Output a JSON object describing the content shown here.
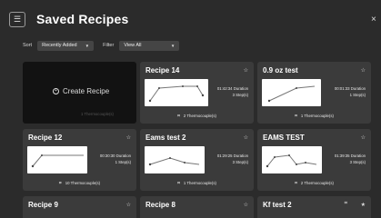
{
  "header": {
    "menu_icon": "☰",
    "title": "Saved Recipes",
    "close_icon": "×"
  },
  "filters": {
    "sort_label": "Sort",
    "sort_value": "Recently Added",
    "filter_label": "Filter",
    "filter_value": "View All",
    "caret": "▼"
  },
  "create": {
    "label": "Create Recipe",
    "plus": "+",
    "ghost": "1 Thermocouple(s)"
  },
  "recipes": [
    {
      "name": "Recipe 14",
      "duration": "01:42:34 Duration",
      "steps": "3 Step(s)",
      "thermocouples": "2 Thermocouple(s)",
      "star": "☆"
    },
    {
      "name": "0.9 oz test",
      "duration": "00:01:33 Duration",
      "steps": "1 Step(s)",
      "thermocouples": "1 Thermocouple(s)",
      "star": "☆"
    },
    {
      "name": "Recipe 12",
      "duration": "00:30:30 Duration",
      "steps": "1 Step(s)",
      "thermocouples": "10 Thermocouple(s)",
      "star": "☆"
    },
    {
      "name": "Eams test 2",
      "duration": "01:29:25 Duration",
      "steps": "3 Step(s)",
      "thermocouples": "1 Thermocouple(s)",
      "star": "☆"
    },
    {
      "name": "EAMS TEST",
      "duration": "01:39:35 Duration",
      "steps": "3 Step(s)",
      "thermocouples": "2 Thermocouple(s)",
      "star": "☆"
    },
    {
      "name": "Recipe 9",
      "star": "☆"
    },
    {
      "name": "Recipe 8",
      "star": "☆"
    },
    {
      "name": "Kf test 2",
      "star": "★"
    }
  ],
  "icons": {
    "thermo": "⌗",
    "extra_icon": "⌗"
  }
}
